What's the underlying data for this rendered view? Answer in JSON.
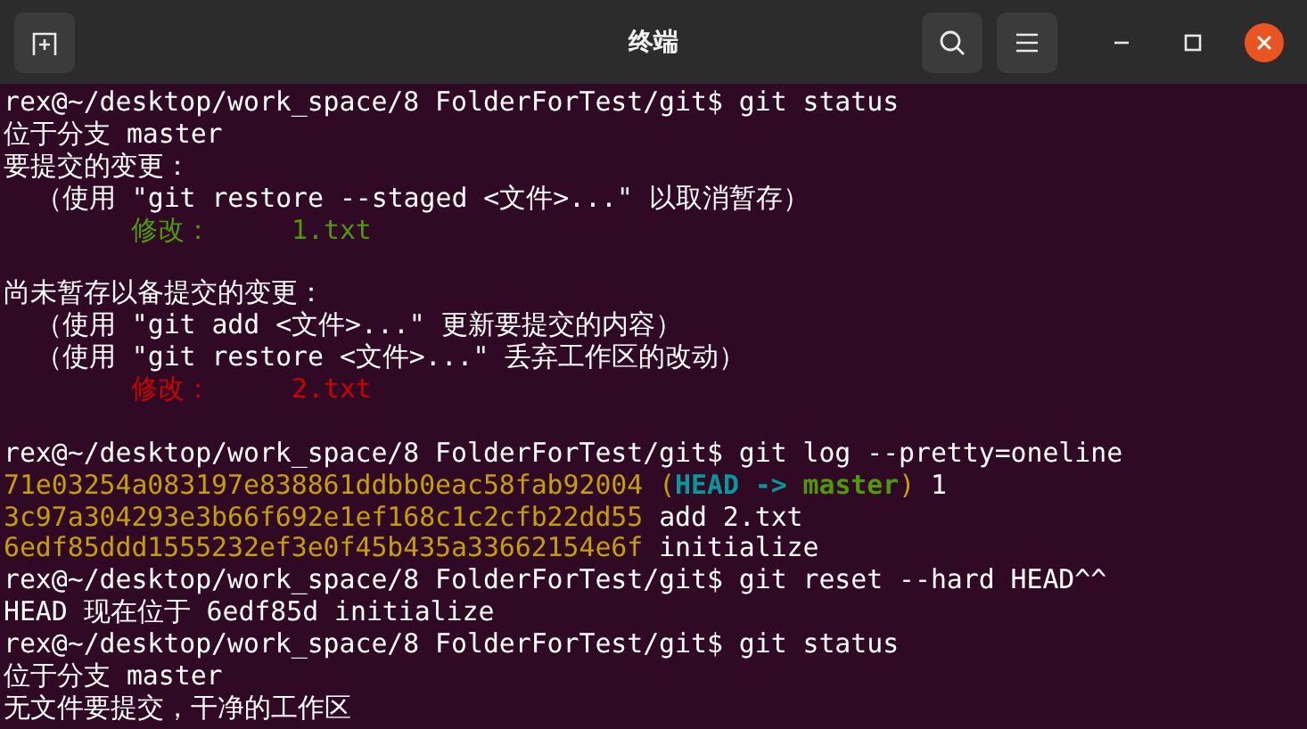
{
  "window": {
    "title": "终端"
  },
  "terminal": {
    "lines": [
      {
        "kind": "text",
        "segments": [
          {
            "text": "rex@~/desktop/work_space/8 FolderForTest/git$ git status",
            "color": "#ffffff",
            "bold": false
          }
        ]
      },
      {
        "kind": "text",
        "segments": [
          {
            "text": "位于分支 master",
            "color": "#ffffff",
            "bold": false
          }
        ]
      },
      {
        "kind": "text",
        "segments": [
          {
            "text": "要提交的变更：",
            "color": "#ffffff",
            "bold": false
          }
        ]
      },
      {
        "kind": "text",
        "segments": [
          {
            "text": "  （使用 \"git restore --staged <文件>...\" 以取消暂存）",
            "color": "#ffffff",
            "bold": false
          }
        ]
      },
      {
        "kind": "text",
        "segments": [
          {
            "text": "        修改：     1.txt",
            "color": "#4e9a06",
            "bold": false
          }
        ]
      },
      {
        "kind": "blank"
      },
      {
        "kind": "text",
        "segments": [
          {
            "text": "尚未暂存以备提交的变更：",
            "color": "#ffffff",
            "bold": false
          }
        ]
      },
      {
        "kind": "text",
        "segments": [
          {
            "text": "  （使用 \"git add <文件>...\" 更新要提交的内容）",
            "color": "#ffffff",
            "bold": false
          }
        ]
      },
      {
        "kind": "text",
        "segments": [
          {
            "text": "  （使用 \"git restore <文件>...\" 丢弃工作区的改动）",
            "color": "#ffffff",
            "bold": false
          }
        ]
      },
      {
        "kind": "text",
        "segments": [
          {
            "text": "        修改：     2.txt",
            "color": "#cc0000",
            "bold": false
          }
        ]
      },
      {
        "kind": "blank"
      },
      {
        "kind": "text",
        "segments": [
          {
            "text": "rex@~/desktop/work_space/8 FolderForTest/git$ git log --pretty=oneline",
            "color": "#ffffff",
            "bold": false
          }
        ]
      },
      {
        "kind": "text",
        "segments": [
          {
            "text": "71e03254a083197e838861ddbb0eac58fab92004",
            "color": "#c4a000",
            "bold": false
          },
          {
            "text": " (",
            "color": "#c4a000",
            "bold": false
          },
          {
            "text": "HEAD -> ",
            "color": "#06989a",
            "bold": true
          },
          {
            "text": "master",
            "color": "#4e9a06",
            "bold": true
          },
          {
            "text": ")",
            "color": "#c4a000",
            "bold": false
          },
          {
            "text": " 1",
            "color": "#ffffff",
            "bold": false
          }
        ]
      },
      {
        "kind": "text",
        "segments": [
          {
            "text": "3c97a304293e3b66f692e1ef168c1c2cfb22dd55",
            "color": "#c4a000",
            "bold": false
          },
          {
            "text": " add 2.txt",
            "color": "#ffffff",
            "bold": false
          }
        ]
      },
      {
        "kind": "text",
        "segments": [
          {
            "text": "6edf85ddd1555232ef3e0f45b435a33662154e6f",
            "color": "#c4a000",
            "bold": false
          },
          {
            "text": " initialize",
            "color": "#ffffff",
            "bold": false
          }
        ]
      },
      {
        "kind": "text",
        "segments": [
          {
            "text": "rex@~/desktop/work_space/8 FolderForTest/git$ git reset --hard HEAD^^",
            "color": "#ffffff",
            "bold": false
          }
        ]
      },
      {
        "kind": "text",
        "segments": [
          {
            "text": "HEAD 现在位于 6edf85d initialize",
            "color": "#ffffff",
            "bold": false
          }
        ]
      },
      {
        "kind": "text",
        "segments": [
          {
            "text": "rex@~/desktop/work_space/8 FolderForTest/git$ git status",
            "color": "#ffffff",
            "bold": false
          }
        ]
      },
      {
        "kind": "text",
        "segments": [
          {
            "text": "位于分支 master",
            "color": "#ffffff",
            "bold": false
          }
        ]
      },
      {
        "kind": "text",
        "segments": [
          {
            "text": "无文件要提交，干净的工作区",
            "color": "#ffffff",
            "bold": false
          }
        ]
      }
    ]
  }
}
